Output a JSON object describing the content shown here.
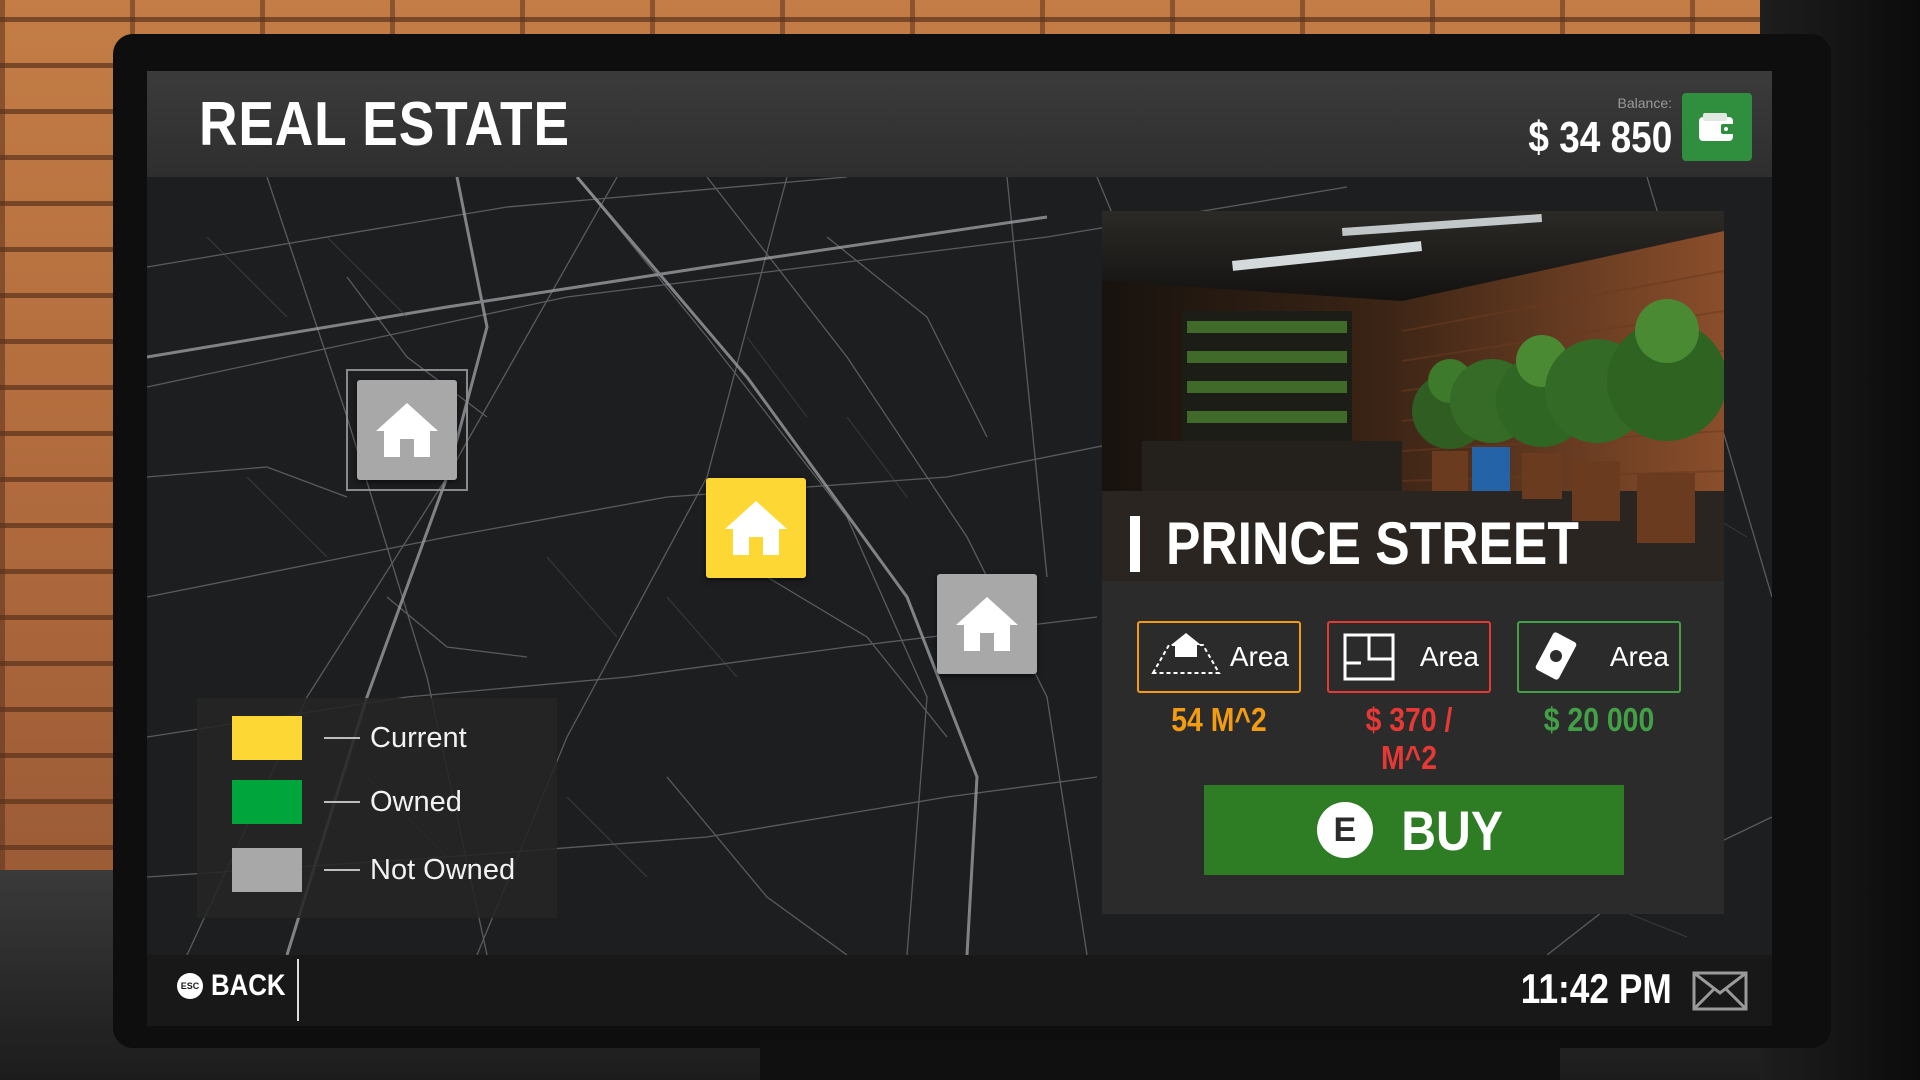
{
  "header": {
    "title": "REAL ESTATE",
    "balance_label": "Balance:",
    "balance_value": "$ 34 850",
    "wallet_icon": "wallet-icon"
  },
  "map": {
    "pins": [
      {
        "status": "Not Owned",
        "icon": "house-icon"
      },
      {
        "status": "Current",
        "icon": "house-icon"
      },
      {
        "status": "Not Owned",
        "icon": "house-icon"
      }
    ],
    "legend": [
      {
        "label": "Current",
        "color": "#fdd835"
      },
      {
        "label": "Owned",
        "color": "#00a53c"
      },
      {
        "label": "Not Owned",
        "color": "#a8a8a8"
      }
    ]
  },
  "property": {
    "name": "PRINCE STREET",
    "stats": [
      {
        "label": "Area",
        "value": "54 M^2",
        "color": "#f39c12",
        "icon": "house-area-icon"
      },
      {
        "label": "Area",
        "value": "$ 370 / M^2",
        "color": "#e53935",
        "icon": "floor-plan-icon"
      },
      {
        "label": "Area",
        "value": "$ 20 000",
        "color": "#43a047",
        "icon": "cash-icon"
      }
    ],
    "buy_key": "E",
    "buy_label": "BUY"
  },
  "footer": {
    "esc_key": "ESC",
    "back_label": "BACK",
    "time": "11:42 PM",
    "mail_icon": "mail-icon"
  },
  "colors": {
    "current": "#fdd835",
    "owned": "#00a53c",
    "not_owned": "#a8a8a8",
    "buy_button": "#2e7d25",
    "wallet": "#2f8f3f"
  }
}
